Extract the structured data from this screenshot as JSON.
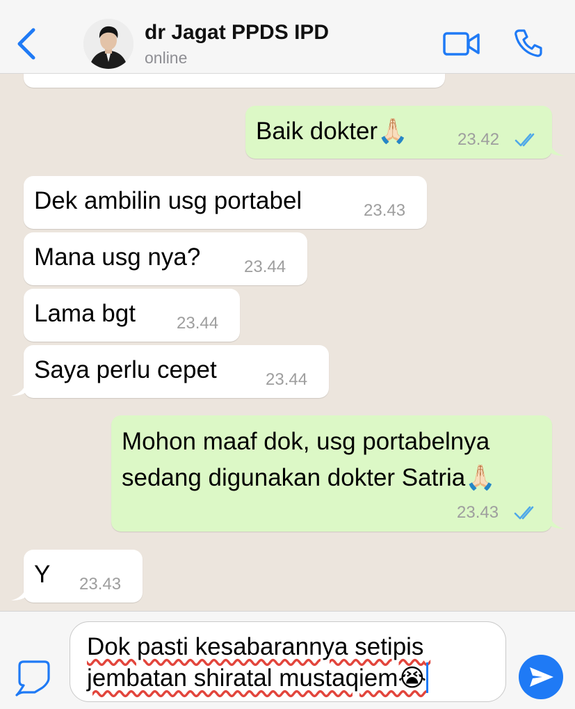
{
  "header": {
    "contact_name": "dr Jagat PPDS IPD",
    "status": "online",
    "icons": {
      "back": "chevron-left-icon",
      "video": "video-camera-icon",
      "call": "phone-icon"
    }
  },
  "colors": {
    "accent": "#1F7AF5",
    "outgoing_bubble": "#DCF8C6",
    "incoming_bubble": "#FFFFFF",
    "chat_background": "#ECE5DD",
    "read_ticks": "#4FA8E8",
    "timestamp": "#9E9E9E"
  },
  "messages": [
    {
      "direction": "incoming",
      "text": "",
      "time": "",
      "partially_visible": true
    },
    {
      "direction": "outgoing",
      "text": "Baik dokter🙏🏻",
      "time": "23.42",
      "read": true
    },
    {
      "direction": "incoming",
      "text": "Dek ambilin usg portabel",
      "time": "23.43"
    },
    {
      "direction": "incoming",
      "text": "Mana usg nya?",
      "time": "23.44"
    },
    {
      "direction": "incoming",
      "text": "Lama bgt",
      "time": "23.44"
    },
    {
      "direction": "incoming",
      "text": "Saya perlu cepet",
      "time": "23.44"
    },
    {
      "direction": "outgoing",
      "text": "Mohon maaf dok, usg portabelnya sedang digunakan dokter Satria🙏🏻",
      "time": "23.43",
      "read": true
    },
    {
      "direction": "incoming",
      "text": "Y",
      "time": "23.43"
    }
  ],
  "composer": {
    "draft_text": "Dok pasti kesabarannya setipis jembatan shiratal mustaqiem😭",
    "icons": {
      "sticker": "sticker-icon",
      "send": "send-icon"
    }
  }
}
